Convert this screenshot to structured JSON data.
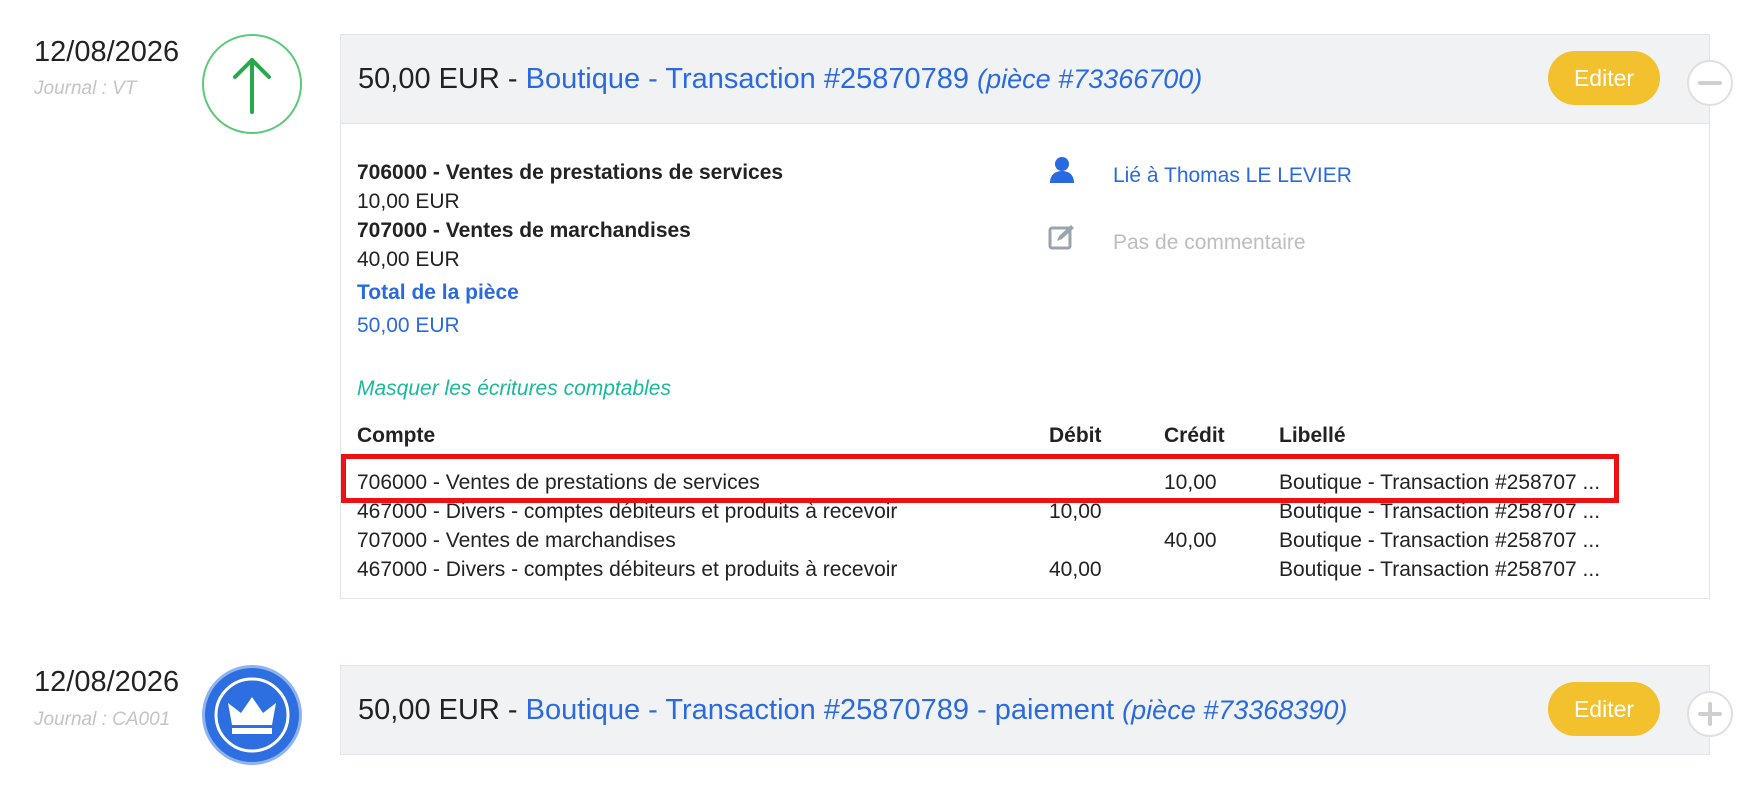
{
  "entries": [
    {
      "date": "12/08/2026",
      "journal": "Journal : VT",
      "icon": "arrow-up-icon",
      "amount": "50,00 EUR",
      "separator": " - ",
      "title_link": "Boutique - Transaction #25870789",
      "piece": "(pièce #73366700)",
      "edit_label": "Editer",
      "toggle": "minus-icon",
      "lines": [
        {
          "account": "706000 - Ventes de prestations de services",
          "amount": "10,00 EUR"
        },
        {
          "account": "707000 - Ventes de marchandises",
          "amount": "40,00 EUR"
        }
      ],
      "total_label": "Total de la pièce",
      "total_amount": "50,00 EUR",
      "linked_label": "Lié à Thomas LE LEVIER",
      "comment_label": "Pas de commentaire",
      "hide_entries_label": "Masquer les écritures comptables",
      "table": {
        "headers": {
          "account": "Compte",
          "debit": "Débit",
          "credit": "Crédit",
          "label": "Libellé"
        },
        "rows": [
          {
            "account": "706000 - Ventes de prestations de services",
            "debit": "",
            "credit": "10,00",
            "label": "Boutique - Transaction #258707 ..."
          },
          {
            "account": "467000 - Divers - comptes débiteurs et produits à recevoir",
            "debit": "10,00",
            "credit": "",
            "label": "Boutique - Transaction #258707 ..."
          },
          {
            "account": "707000 - Ventes de marchandises",
            "debit": "",
            "credit": "40,00",
            "label": "Boutique - Transaction #258707 ..."
          },
          {
            "account": "467000 - Divers - comptes débiteurs et produits à recevoir",
            "debit": "40,00",
            "credit": "",
            "label": "Boutique - Transaction #258707 ..."
          }
        ]
      }
    },
    {
      "date": "12/08/2026",
      "journal": "Journal : CA001",
      "icon": "crown-icon",
      "amount": "50,00 EUR",
      "separator": " - ",
      "title_link": "Boutique - Transaction #25870789 - paiement",
      "piece": "(pièce #73368390)",
      "edit_label": "Editer",
      "toggle": "plus-icon"
    }
  ],
  "colors": {
    "accent_blue": "#2a6ae0",
    "edit_yellow": "#f3c02e",
    "teal": "#1ab99a",
    "highlight_red": "#ee1111",
    "up_green": "#5cc97a"
  }
}
